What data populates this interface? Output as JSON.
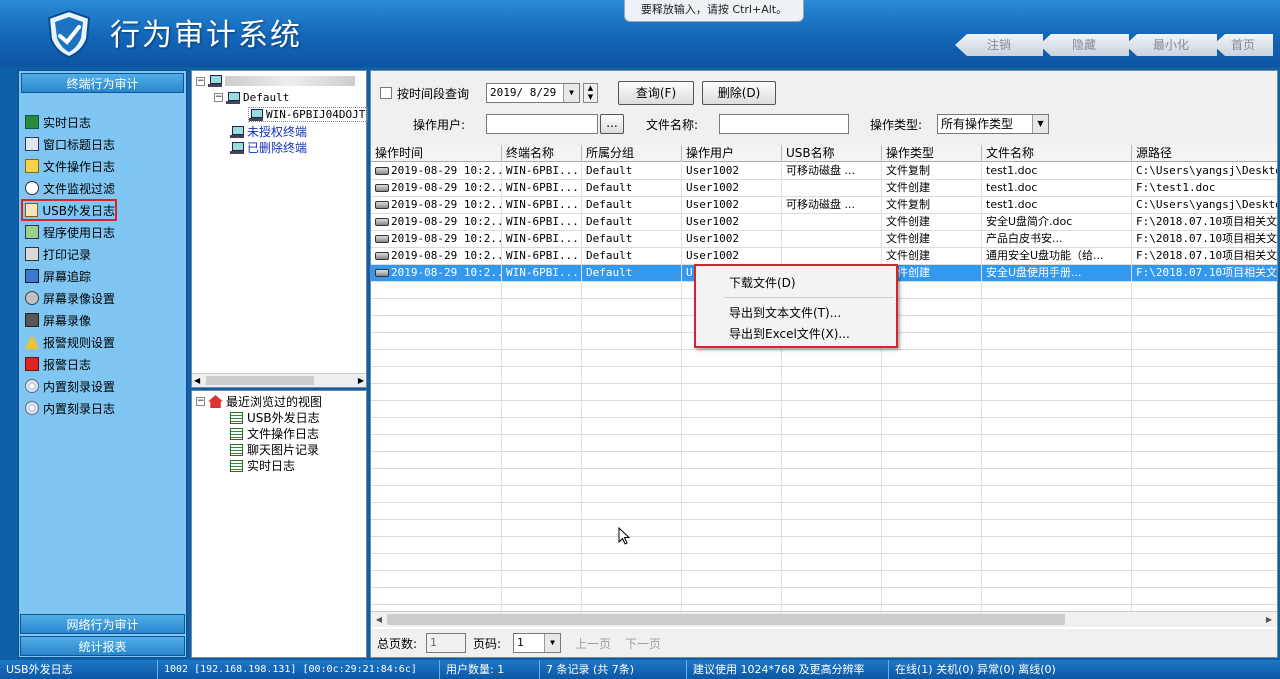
{
  "header": {
    "title": "行为审计系统",
    "toast": "要释放输入，请按 Ctrl+Alt。",
    "nav": [
      "注销",
      "隐藏",
      "最小化",
      "首页"
    ]
  },
  "sidebar": {
    "section_top": "终端行为审计",
    "items": [
      {
        "label": "实时日志",
        "icon": "list-icon"
      },
      {
        "label": "窗口标题日志",
        "icon": "window-icon"
      },
      {
        "label": "文件操作日志",
        "icon": "file-icon"
      },
      {
        "label": "文件监视过滤",
        "icon": "monitor-icon"
      },
      {
        "label": "USB外发日志",
        "icon": "usb-icon",
        "active": true
      },
      {
        "label": "程序使用日志",
        "icon": "program-icon"
      },
      {
        "label": "打印记录",
        "icon": "printer-icon"
      },
      {
        "label": "屏幕追踪",
        "icon": "screen-icon"
      },
      {
        "label": "屏幕录像设置",
        "icon": "gear-icon"
      },
      {
        "label": "屏幕录像",
        "icon": "camera-icon"
      },
      {
        "label": "报警规则设置",
        "icon": "warning-icon"
      },
      {
        "label": "报警日志",
        "icon": "alarm-icon"
      },
      {
        "label": "内置刻录设置",
        "icon": "disc-icon"
      },
      {
        "label": "内置刻录日志",
        "icon": "disc-icon"
      }
    ],
    "section_network": "网络行为审计",
    "section_report": "统计报表"
  },
  "tree": {
    "group": "Default",
    "terminal": "WIN-6PBIJ04DOJT",
    "unauthorized": "未授权终端",
    "deleted": "已删除终端"
  },
  "recent": {
    "title": "最近浏览过的视图",
    "items": [
      "USB外发日志",
      "文件操作日志",
      "聊天图片记录",
      "实时日志"
    ]
  },
  "filter": {
    "time_range_label": "按时间段查询",
    "date": "2019/ 8/29",
    "query_button": "查询(F)",
    "delete_button": "删除(D)",
    "user_label": "操作用户:",
    "user_value": "",
    "browse_button": "...",
    "filename_label": "文件名称:",
    "filename_value": "",
    "optype_label": "操作类型:",
    "optype_value": "所有操作类型"
  },
  "table": {
    "columns": [
      "操作时间",
      "终端名称",
      "所属分组",
      "操作用户",
      "USB名称",
      "操作类型",
      "文件名称",
      "源路径"
    ],
    "rows": [
      [
        "2019-08-29 10:2...",
        "WIN-6PBI...",
        "Default",
        "User1002",
        "可移动磁盘 ...",
        "文件复制",
        "test1.doc",
        "C:\\Users\\yangsj\\Desktop"
      ],
      [
        "2019-08-29 10:2...",
        "WIN-6PBI...",
        "Default",
        "User1002",
        "",
        "文件创建",
        "test1.doc",
        "F:\\test1.doc"
      ],
      [
        "2019-08-29 10:2...",
        "WIN-6PBI...",
        "Default",
        "User1002",
        "可移动磁盘 ...",
        "文件复制",
        "test1.doc",
        "C:\\Users\\yangsj\\Desktop"
      ],
      [
        "2019-08-29 10:2...",
        "WIN-6PBI...",
        "Default",
        "User1002",
        "",
        "文件创建",
        "安全U盘简介.doc",
        "F:\\2018.07.10项目相关文"
      ],
      [
        "2019-08-29 10:2...",
        "WIN-6PBI...",
        "Default",
        "User1002",
        "",
        "文件创建",
        "产品白皮书安...",
        "F:\\2018.07.10项目相关文"
      ],
      [
        "2019-08-29 10:2...",
        "WIN-6PBI...",
        "Default",
        "User1002",
        "",
        "文件创建",
        "通用安全U盘功能（给...",
        "F:\\2018.07.10项目相关文"
      ],
      [
        "2019-08-29 10:2...",
        "WIN-6PBI...",
        "Default",
        "U",
        "",
        "文件创建",
        "安全U盘使用手册...",
        "F:\\2018.07.10项目相关文"
      ]
    ]
  },
  "context_menu": {
    "download": "下载文件(D)",
    "export_text": "导出到文本文件(T)...",
    "export_excel": "导出到Excel文件(X)..."
  },
  "pager": {
    "total_label": "总页数:",
    "total_value": "1",
    "page_label": "页码:",
    "page_value": "1",
    "prev": "上一页",
    "next": "下一页"
  },
  "status": {
    "view": "USB外发日志",
    "connection": "1002 [192.168.198.131] [00:0c:29:21:84:6c]",
    "users": "用户数量: 1",
    "records": "7 条记录 (共 7条)",
    "resolution": "建议使用 1024*768 及更高分辨率",
    "online": "在线(1) 关机(0) 异常(0) 离线(0)"
  },
  "colors": {
    "header": "#1366b8",
    "sidebar_bg": "#7fc6f2",
    "selection": "#3399ee",
    "highlight_border": "#d4252f"
  }
}
